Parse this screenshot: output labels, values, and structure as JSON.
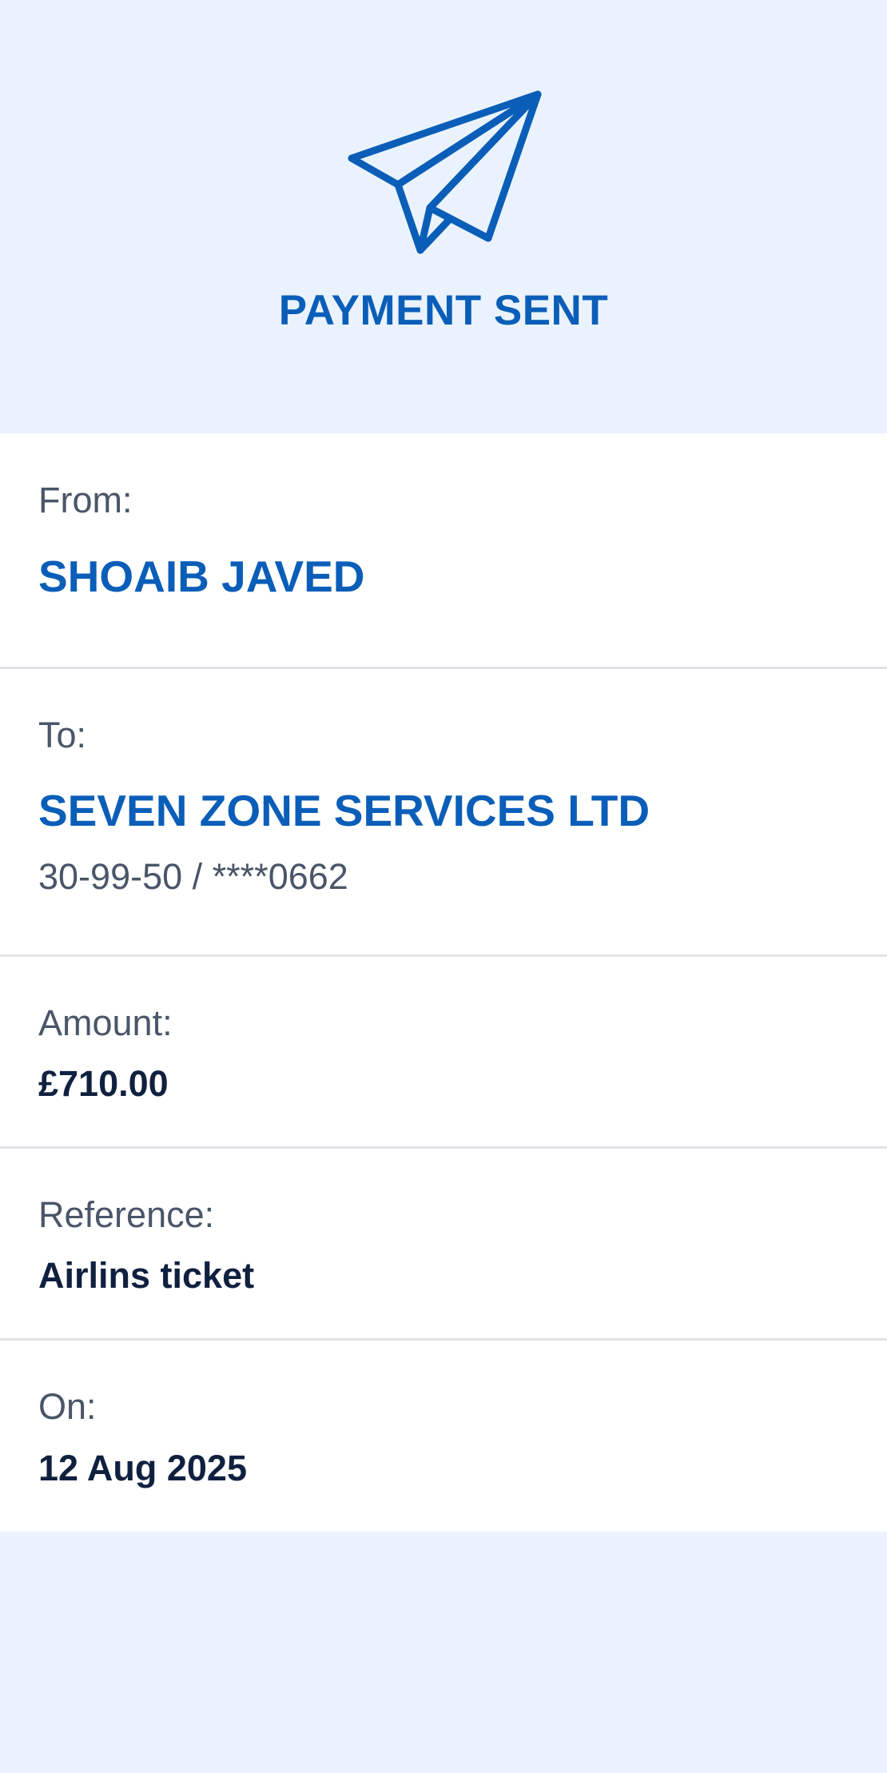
{
  "header": {
    "icon": "paper-plane-icon",
    "title": "PAYMENT SENT"
  },
  "details": {
    "from": {
      "label": "From:",
      "name": "SHOAIB JAVED"
    },
    "to": {
      "label": "To:",
      "name": "SEVEN ZONE SERVICES LTD",
      "account": "30-99-50 / ****0662"
    },
    "amount": {
      "label": "Amount:",
      "value": "£710.00"
    },
    "reference": {
      "label": "Reference:",
      "value": "Airlins ticket"
    },
    "date": {
      "label": "On:",
      "value": "12 Aug 2025"
    }
  },
  "colors": {
    "accent": "#0A5EB8",
    "background": "#EAF3FD",
    "label": "#4A5568",
    "value": "#10203F",
    "divider": "#E0E2E6"
  }
}
